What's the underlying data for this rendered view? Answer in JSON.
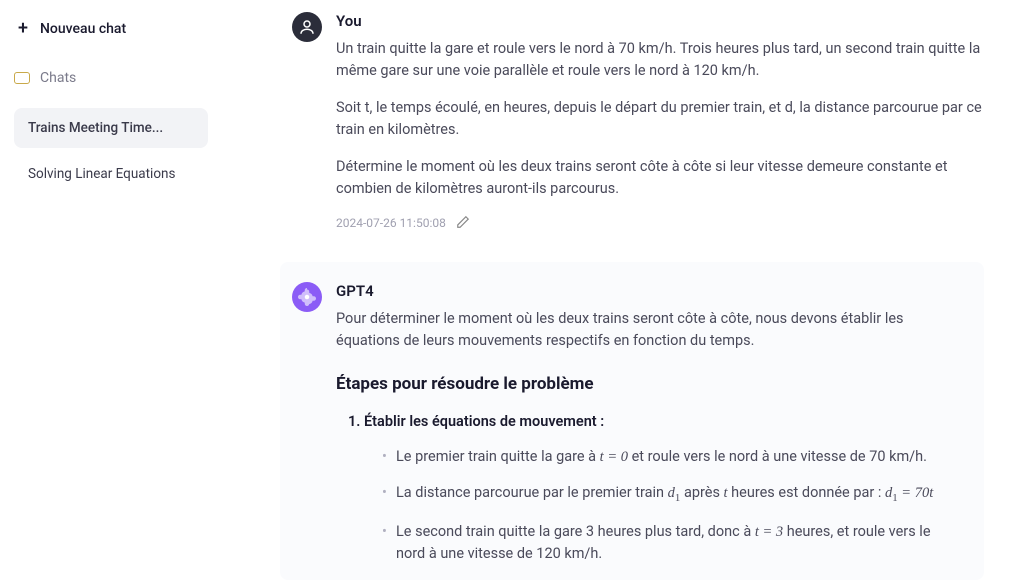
{
  "sidebar": {
    "new_chat_label": "Nouveau chat",
    "chats_label": "Chats",
    "items": [
      {
        "label": "Trains Meeting Time...",
        "active": true
      },
      {
        "label": "Solving Linear Equations",
        "active": false
      }
    ]
  },
  "conversation": {
    "user": {
      "name": "You",
      "paragraphs": [
        "Un train quitte la gare et roule vers le nord à 70 km/h. Trois heures plus tard, un second train quitte la même gare sur une voie parallèle et roule vers le nord à 120 km/h.",
        "Soit t, le temps écoulé, en heures, depuis le départ du premier train, et d, la distance parcourue par ce train en kilomètres.",
        "Détermine le moment où les deux trains seront côte à côte si leur vitesse demeure constante et combien de kilomètres auront-ils parcourus."
      ],
      "timestamp": "2024-07-26 11:50:08"
    },
    "assistant": {
      "name": "GPT4",
      "intro": "Pour déterminer le moment où les deux trains seront côte à côte, nous devons établir les équations de leurs mouvements respectifs en fonction du temps.",
      "section_heading": "Étapes pour résoudre le problème",
      "step1_title": "Établir les équations de mouvement :",
      "bullets": {
        "b1_pre": "Le premier train quitte la gare à ",
        "b1_math": "t = 0",
        "b1_post": " et roule vers le nord à une vitesse de 70 km/h.",
        "b2_pre": "La distance parcourue par le premier train ",
        "b2_math1": "d₁",
        "b2_mid": " après ",
        "b2_math2": "t",
        "b2_post": " heures est donnée par : ",
        "b2_eq": "d₁ = 70t",
        "b3_pre": "Le second train quitte la gare 3 heures plus tard, donc à ",
        "b3_math": "t = 3",
        "b3_post": " heures, et roule vers le nord à une vitesse de 120 km/h."
      }
    }
  }
}
